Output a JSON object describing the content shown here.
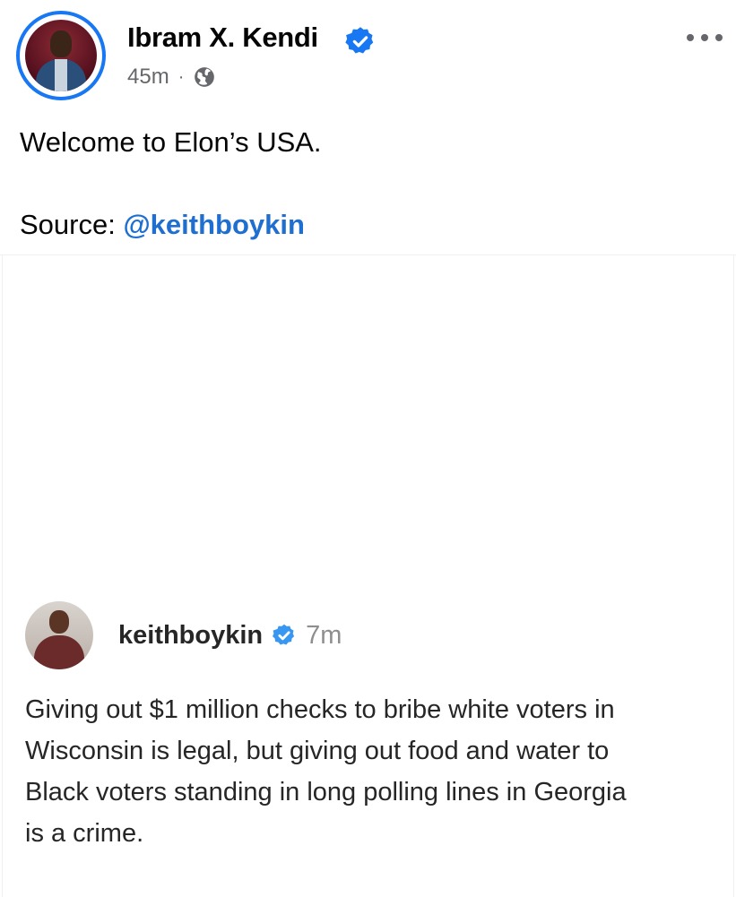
{
  "post": {
    "author": "Ibram X. Kendi",
    "time": "45m",
    "separator": "·",
    "visibility_icon": "globe-icon",
    "verified_icon": "verified-badge-icon",
    "more_icon": "more-options-icon",
    "text_line1": "Welcome to Elon’s USA.",
    "source_label": "Source: ",
    "source_mention": "@keithboykin"
  },
  "quote": {
    "username": "keithboykin",
    "time": "7m",
    "verified_icon": "verified-badge-icon",
    "lines": [
      "Giving out $1 million checks to bribe white voters in",
      "Wisconsin is legal, but giving out food and water to",
      "Black voters standing in long polling lines in Georgia",
      "is a crime."
    ]
  },
  "colors": {
    "accent": "#1877f2",
    "mention": "#1f6fd1",
    "meta": "#65676b",
    "quote_time": "#8e8e8e"
  }
}
